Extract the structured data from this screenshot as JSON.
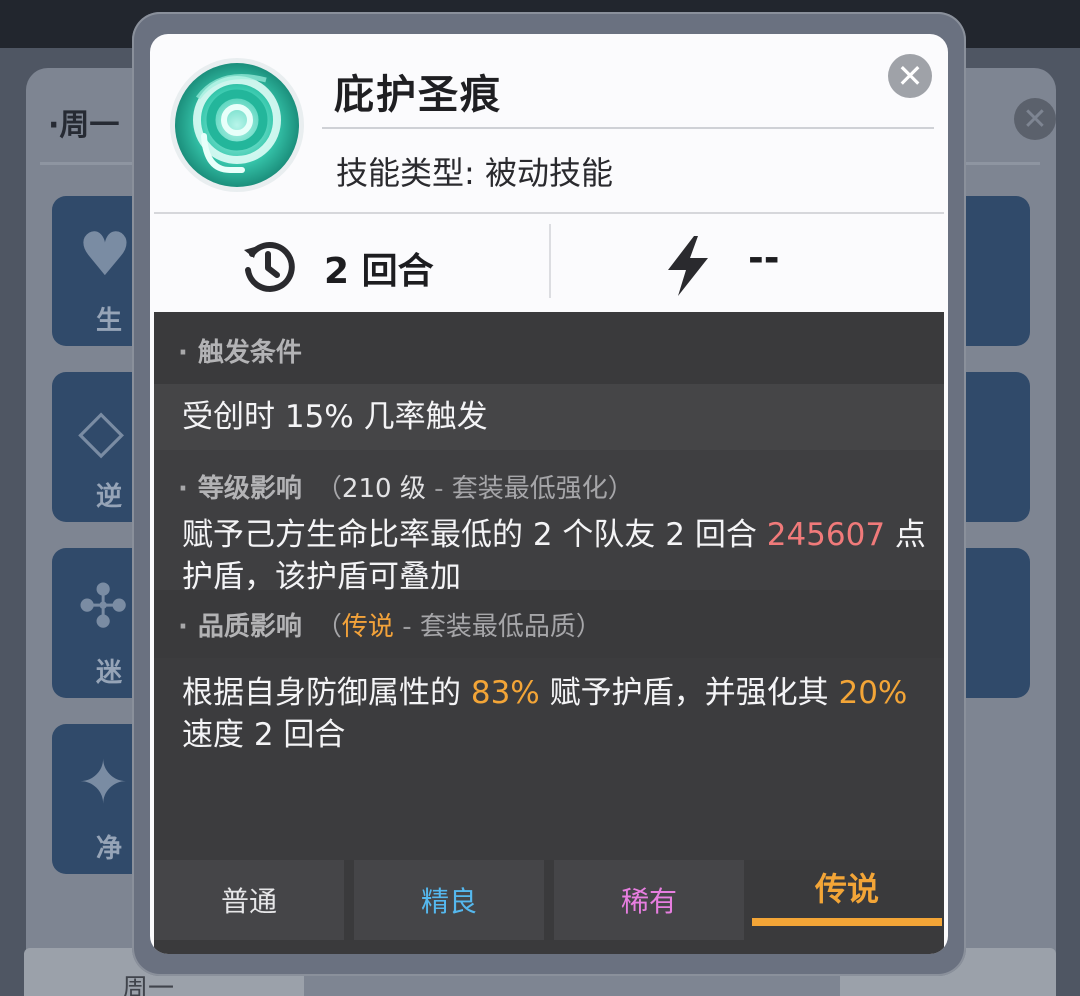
{
  "background": {
    "panel_title": "·周一",
    "tile_labels": [
      "生",
      "逆",
      "迷",
      "净"
    ],
    "bottom_tab_label": "周一"
  },
  "skill": {
    "title": "庇护圣痕",
    "type_label": "技能类型:",
    "type_value": "被动技能",
    "close_symbol": "✕",
    "icon": "shield-swirl-skill-icon"
  },
  "stats": {
    "cooldown_value": "2 回合",
    "cooldown_icon": "clock-history-icon",
    "energy_value": "--",
    "energy_icon": "lightning-bolt-icon"
  },
  "sections": {
    "trigger": {
      "header": "触发条件",
      "text": "受创时 15% 几率触发"
    },
    "level": {
      "header": "等级影响",
      "note_open": "（",
      "note_value": "210 级",
      "note_sep": " - ",
      "note_desc": "套装最低强化",
      "note_close": "）",
      "text_pre": "赋予己方生命比率最低的 2 个队友 2 回合 ",
      "text_value": "245607",
      "text_post": " 点护盾，该护盾可叠加"
    },
    "quality": {
      "header": "品质影响",
      "note_open": "（",
      "note_value": "传说",
      "note_sep": " - ",
      "note_desc": "套装最低品质",
      "note_close": "）",
      "text_1": "根据自身防御属性的 ",
      "text_val1": "83%",
      "text_2": " 赋予护盾，并强化其 ",
      "text_val2": "20%",
      "text_3": " 速度 2 回合"
    }
  },
  "quality_tabs": [
    {
      "label": "普通",
      "color": "#e6e6e8",
      "active": false
    },
    {
      "label": "精良",
      "color": "#55b8ee",
      "active": false
    },
    {
      "label": "稀有",
      "color": "#e77ee0",
      "active": false
    },
    {
      "label": "传说",
      "color": "#f3a537",
      "active": true
    }
  ],
  "colors": {
    "accent_orange": "#f3a537",
    "value_red": "#f07a7a",
    "desc_bg": "#3a3a3c"
  }
}
